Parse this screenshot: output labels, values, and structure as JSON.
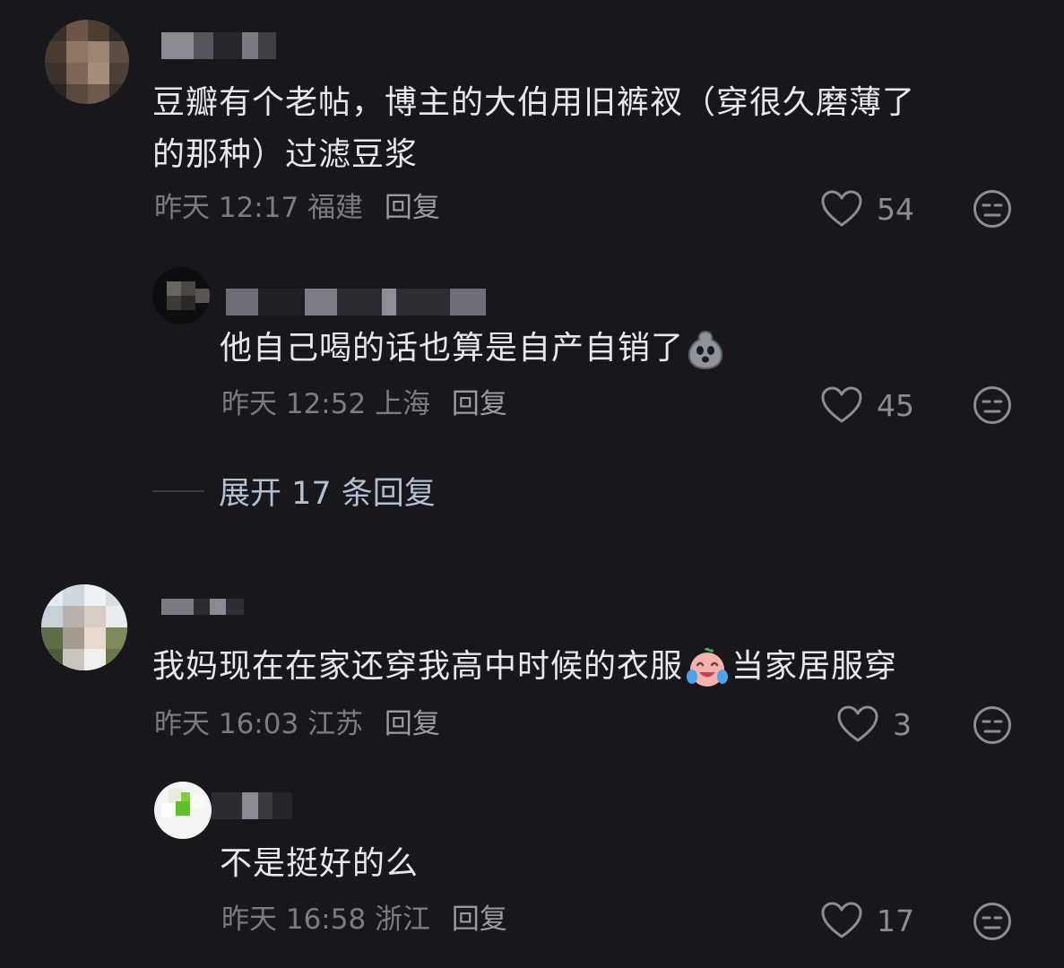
{
  "comments": [
    {
      "text_line1": "豆瓣有个老帖，博主的大伯用旧裤衩（穿很久磨薄了",
      "text_line2": "的那种）过滤豆浆",
      "time": "昨天 12:17",
      "location": "福建",
      "reply_label": "回复",
      "likes": "54",
      "replies": [
        {
          "text": "他自己喝的话也算是自产自销了",
          "time": "昨天 12:52",
          "location": "上海",
          "reply_label": "回复",
          "likes": "45"
        }
      ],
      "expand_label": "展开 17 条回复"
    },
    {
      "text_before_emoji": "我妈现在在家还穿我高中时候的衣服",
      "text_after_emoji": "当家居服穿",
      "time": "昨天 16:03",
      "location": "江苏",
      "reply_label": "回复",
      "likes": "3",
      "replies": [
        {
          "text": "不是挺好的么",
          "time": "昨天 16:58",
          "location": "浙江",
          "reply_label": "回复",
          "likes": "17"
        }
      ]
    }
  ],
  "icons": {
    "like": "heart-outline-icon",
    "emoji_react": "expressionless-face-icon",
    "inline_1": "gourd-ghost-emoji",
    "inline_2": "crying-laughing-emoji"
  },
  "colors": {
    "background": "#17171c",
    "text": "#e8e8ec",
    "meta": "#7b7b84",
    "expand": "#b4bfd2"
  }
}
